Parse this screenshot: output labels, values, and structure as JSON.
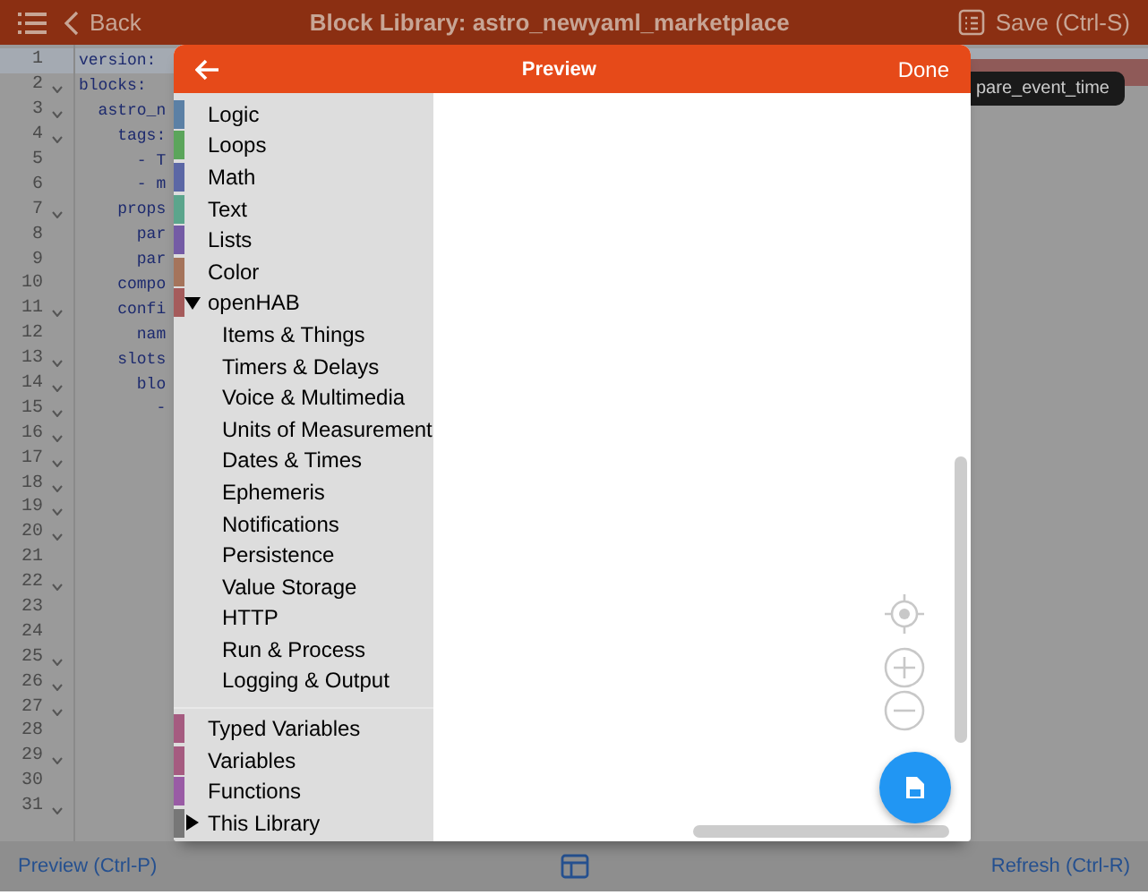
{
  "top_bar": {
    "back": "Back",
    "title": "Block Library: astro_newyaml_marketplace",
    "save": "Save (Ctrl-S)"
  },
  "editor": {
    "lines": [
      {
        "number": "1",
        "text": "version:",
        "foldable": false,
        "current": true
      },
      {
        "number": "2",
        "text": "blocks:",
        "foldable": true,
        "current": false
      },
      {
        "number": "3",
        "text": "  astro_n",
        "foldable": true,
        "current": false
      },
      {
        "number": "4",
        "text": "    tags:",
        "foldable": true,
        "current": false
      },
      {
        "number": "5",
        "text": "      - T",
        "foldable": false,
        "current": false
      },
      {
        "number": "6",
        "text": "      - m",
        "foldable": false,
        "current": false
      },
      {
        "number": "7",
        "text": "    props",
        "foldable": true,
        "current": false
      },
      {
        "number": "8",
        "text": "      par",
        "foldable": false,
        "current": false
      },
      {
        "number": "9",
        "text": "      par",
        "foldable": false,
        "current": false
      },
      {
        "number": "10",
        "text": "    compo",
        "foldable": false,
        "current": false
      },
      {
        "number": "11",
        "text": "    confi",
        "foldable": true,
        "current": false
      },
      {
        "number": "12",
        "text": "      nam",
        "foldable": false,
        "current": false
      },
      {
        "number": "13",
        "text": "    slots",
        "foldable": true,
        "current": false
      },
      {
        "number": "14",
        "text": "      blo",
        "foldable": true,
        "current": false
      },
      {
        "number": "15",
        "text": "        -",
        "foldable": true,
        "current": false
      },
      {
        "number": "16",
        "foldable": true,
        "current": false
      },
      {
        "number": "17",
        "foldable": true,
        "current": false
      },
      {
        "number": "18",
        "foldable": true,
        "current": false
      },
      {
        "number": "19",
        "foldable": true,
        "current": false
      },
      {
        "number": "20",
        "foldable": true,
        "current": false
      },
      {
        "number": "21",
        "foldable": false,
        "current": false
      },
      {
        "number": "22",
        "foldable": true,
        "current": false
      },
      {
        "number": "23",
        "foldable": false,
        "current": false
      },
      {
        "number": "24",
        "foldable": false,
        "current": false
      },
      {
        "number": "25",
        "foldable": true,
        "current": false
      },
      {
        "number": "26",
        "foldable": true,
        "current": false
      },
      {
        "number": "27",
        "foldable": true,
        "current": false
      },
      {
        "number": "28",
        "foldable": false,
        "current": false
      },
      {
        "number": "29",
        "foldable": true,
        "current": false
      },
      {
        "number": "30",
        "foldable": false,
        "current": false
      },
      {
        "number": "31",
        "foldable": true,
        "current": false
      }
    ],
    "tooltip": "pare_event_time"
  },
  "dialog": {
    "title": "Preview",
    "done": "Done",
    "toolbox": {
      "groups": [
        {
          "categories": [
            {
              "label": "Logic",
              "color": "#5b80a5"
            },
            {
              "label": "Loops",
              "color": "#5ba55b"
            },
            {
              "label": "Math",
              "color": "#5b67a5"
            },
            {
              "label": "Text",
              "color": "#5ba58c"
            },
            {
              "label": "Lists",
              "color": "#745ba5"
            },
            {
              "label": "Color",
              "color": "#a5745b"
            },
            {
              "label": "openHAB",
              "color": "#a55b5b",
              "expanded": true,
              "children": [
                {
                  "label": "Items & Things"
                },
                {
                  "label": "Timers & Delays"
                },
                {
                  "label": "Voice & Multimedia"
                },
                {
                  "label": "Units of Measurement"
                },
                {
                  "label": "Dates & Times"
                },
                {
                  "label": "Ephemeris"
                },
                {
                  "label": "Notifications"
                },
                {
                  "label": "Persistence"
                },
                {
                  "label": "Value Storage"
                },
                {
                  "label": "HTTP"
                },
                {
                  "label": "Run & Process"
                },
                {
                  "label": "Logging & Output"
                }
              ]
            }
          ]
        },
        {
          "categories": [
            {
              "label": "Typed Variables",
              "color": "#a55b80"
            },
            {
              "label": "Variables",
              "color": "#a55b80"
            },
            {
              "label": "Functions",
              "color": "#995ba5"
            },
            {
              "label": "This Library",
              "color": "#777777",
              "expanded": false
            }
          ]
        }
      ]
    }
  },
  "bottom_bar": {
    "preview": "Preview (Ctrl-P)",
    "refresh": "Refresh (Ctrl-R)"
  }
}
